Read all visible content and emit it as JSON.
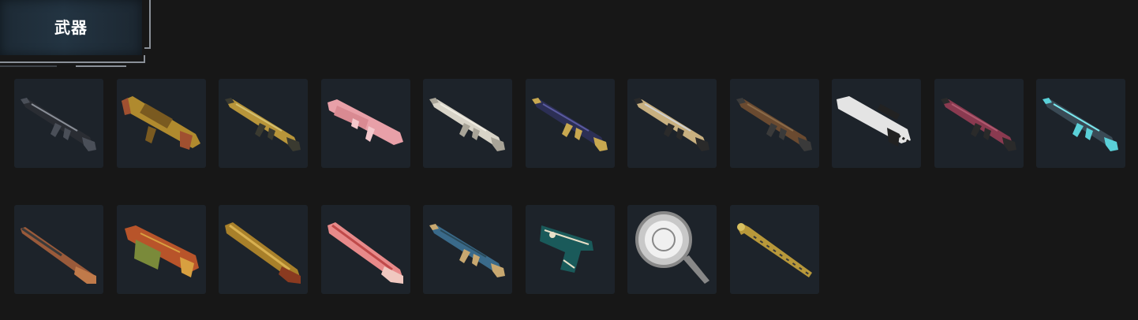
{
  "section": {
    "title": "武器"
  },
  "weapons": [
    {
      "icon": "assault-rifle-black-icon",
      "body": "#2a2d33",
      "accent": "#4a4f58",
      "detail": "#8a8f98",
      "shape": "rifle"
    },
    {
      "icon": "grenade-launcher-gold-icon",
      "body": "#b08a2e",
      "accent": "#7a5a20",
      "detail": "#a05030",
      "shape": "launcher"
    },
    {
      "icon": "assault-rifle-gold-icon",
      "body": "#b8953a",
      "accent": "#3a3a30",
      "detail": "#d4c070",
      "shape": "rifle"
    },
    {
      "icon": "bullpup-rifle-pink-icon",
      "body": "#e8a0a8",
      "accent": "#d98a92",
      "detail": "#f4c8cc",
      "shape": "bullpup"
    },
    {
      "icon": "assault-rifle-white-icon",
      "body": "#d8d4c8",
      "accent": "#a8a498",
      "detail": "#efece2",
      "shape": "rifle"
    },
    {
      "icon": "assault-rifle-navy-gold-icon",
      "body": "#2c2f55",
      "accent": "#c8a850",
      "detail": "#5a5aa0",
      "shape": "rifle"
    },
    {
      "icon": "assault-rifle-tan-icon",
      "body": "#c8b080",
      "accent": "#2a2a2a",
      "detail": "#d0d0d0",
      "shape": "rifle"
    },
    {
      "icon": "battle-rifle-brown-icon",
      "body": "#6a4a30",
      "accent": "#3a3a3a",
      "detail": "#8a6a48",
      "shape": "rifle"
    },
    {
      "icon": "sniper-rifle-white-icon",
      "body": "#e4e4e4",
      "accent": "#222222",
      "detail": "#ffffff",
      "shape": "sniper"
    },
    {
      "icon": "assault-rifle-maroon-icon",
      "body": "#8a3a50",
      "accent": "#2a2a2a",
      "detail": "#b05a70",
      "shape": "rifle"
    },
    {
      "icon": "assault-rifle-teal-icon",
      "body": "#3a4a55",
      "accent": "#5ad0d8",
      "detail": "#7ae8ee",
      "shape": "rifle"
    },
    {
      "icon": "bolt-rifle-wood-icon",
      "body": "#9a5a3a",
      "accent": "#3a3a3a",
      "detail": "#c07a4a",
      "shape": "bolt"
    },
    {
      "icon": "smg-orange-camo-icon",
      "body": "#b8542a",
      "accent": "#7a8a3a",
      "detail": "#d8a040",
      "shape": "smg"
    },
    {
      "icon": "shotgun-gold-wood-icon",
      "body": "#a8802a",
      "accent": "#8a3a20",
      "detail": "#d8b050",
      "shape": "shotgun"
    },
    {
      "icon": "shotgun-pink-floral-icon",
      "body": "#e88a8a",
      "accent": "#f0c8c0",
      "detail": "#c04a4a",
      "shape": "shotgun"
    },
    {
      "icon": "assault-rifle-blue-dotted-icon",
      "body": "#3a6a8a",
      "accent": "#c8a870",
      "detail": "#2a4a5a",
      "shape": "rifle"
    },
    {
      "icon": "pistol-teal-camo-icon",
      "body": "#1a5a5a",
      "accent": "#e8e0c8",
      "detail": "#0a3a3a",
      "shape": "pistol"
    },
    {
      "icon": "frying-pan-silver-icon",
      "body": "#c8c8c8",
      "accent": "#888888",
      "detail": "#f0f0f0",
      "shape": "pan"
    },
    {
      "icon": "crowbar-gold-icon",
      "body": "#b8983a",
      "accent": "#3a3a3a",
      "detail": "#d8c060",
      "shape": "crowbar"
    }
  ]
}
